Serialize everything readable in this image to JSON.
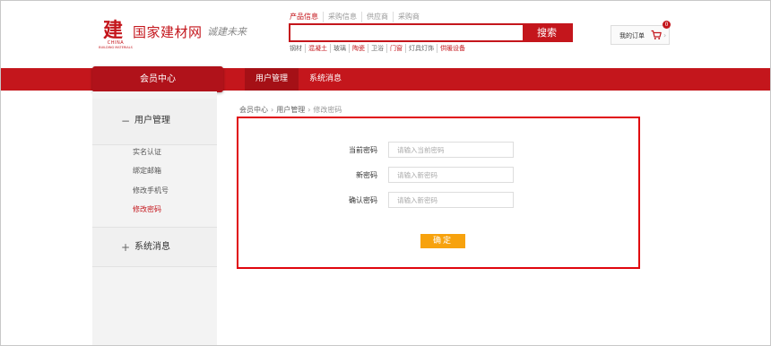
{
  "header": {
    "logo_glyph": "建",
    "logo_sub_en": "CHINA",
    "logo_sub_en2": "BUILDING MATERIALS",
    "title": "国家建材网",
    "slogan": "诚建未来"
  },
  "search": {
    "tabs": [
      "产品信息",
      "采购信息",
      "供应商",
      "采购商"
    ],
    "placeholder": "",
    "button": "搜索",
    "hotwords": [
      {
        "label": "钢材",
        "highlight": false
      },
      {
        "label": "混凝土",
        "highlight": true
      },
      {
        "label": "玻璃",
        "highlight": false
      },
      {
        "label": "陶瓷",
        "highlight": true
      },
      {
        "label": "卫浴",
        "highlight": false
      },
      {
        "label": "门窗",
        "highlight": true
      },
      {
        "label": "灯具灯饰",
        "highlight": false
      },
      {
        "label": "供暖设备",
        "highlight": true
      }
    ]
  },
  "orders": {
    "label": "我的订单",
    "count": "0",
    "icon": "cart-icon"
  },
  "nav": {
    "member_center": "会员中心",
    "items": [
      "用户管理",
      "系统消息"
    ]
  },
  "sidebar": {
    "groups": [
      {
        "sign": "−",
        "label": "用户管理",
        "items": [
          "实名认证",
          "绑定邮箱",
          "修改手机号",
          "修改密码"
        ]
      },
      {
        "sign": "+",
        "label": "系统消息",
        "items": []
      }
    ]
  },
  "breadcrumb": [
    "会员中心",
    "用户管理",
    "修改密码"
  ],
  "form": {
    "fields": [
      {
        "label": "当前密码",
        "placeholder": "请输入当前密码"
      },
      {
        "label": "新密码",
        "placeholder": "请输入新密码"
      },
      {
        "label": "确认密码",
        "placeholder": "请输入新密码"
      }
    ],
    "submit": "确定"
  },
  "colors": {
    "brand": "#c4161c",
    "accent": "#f7a20d",
    "highlight_border": "#e0060e"
  }
}
